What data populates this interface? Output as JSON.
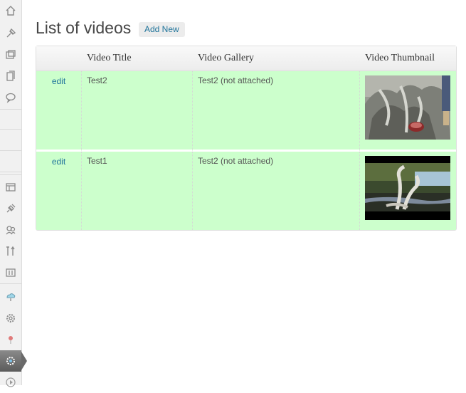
{
  "sidebar": {
    "items": [
      {
        "icon": "dashboard-icon"
      },
      {
        "icon": "posts-icon"
      },
      {
        "icon": "media-icon"
      },
      {
        "icon": "pages-icon"
      },
      {
        "icon": "comments-icon"
      },
      {
        "icon": "appearance-icon"
      },
      {
        "icon": "plugins-icon"
      },
      {
        "icon": "users-icon"
      },
      {
        "icon": "tools-icon"
      },
      {
        "icon": "settings-icon"
      },
      {
        "icon": "cloud-plugin-icon"
      },
      {
        "icon": "gear-plugin-icon"
      },
      {
        "icon": "pin-plugin-icon"
      },
      {
        "icon": "video-gallery-icon",
        "active": true
      },
      {
        "icon": "play-icon"
      }
    ]
  },
  "header": {
    "title": "List of videos",
    "add_new_label": "Add New"
  },
  "table": {
    "columns": [
      "",
      "Video Title",
      "Video Gallery",
      "Video Thumbnail"
    ],
    "rows": [
      {
        "action": "edit",
        "title": "Test2",
        "gallery": "Test2 (not attached)",
        "thumbnail": "driftwood-sculpture-photo"
      },
      {
        "action": "edit",
        "title": "Test1",
        "gallery": "Test2 (not attached)",
        "thumbnail": "river-driftwood-photo"
      }
    ]
  },
  "colors": {
    "row_bg": "#ccffcc",
    "link": "#21759b",
    "header_bg": "#ececec"
  }
}
